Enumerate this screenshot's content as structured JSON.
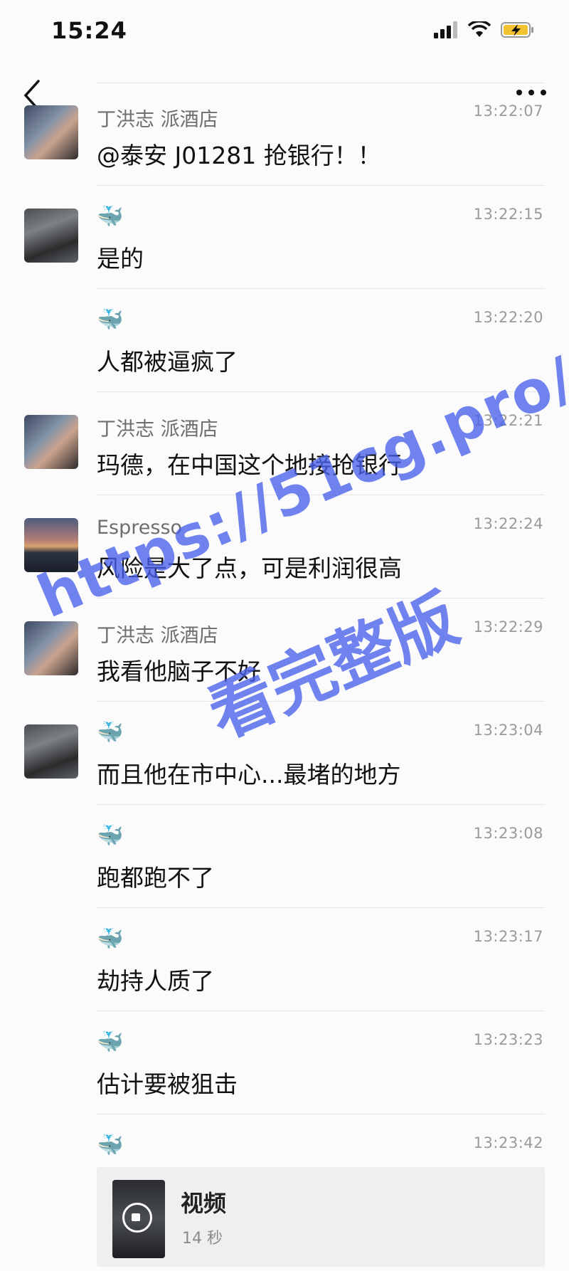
{
  "status_bar": {
    "time": "15:24"
  },
  "messages": [
    {
      "sender": "丁洪志 派酒店",
      "avatar": "couple-photo",
      "time": "13:22:07",
      "text": "@泰安 J01281 抢银行！！"
    },
    {
      "sender_icon": "🐳",
      "avatar": "dark-photo",
      "time": "13:22:15",
      "text": "是的"
    },
    {
      "sender_icon": "🐳",
      "avatar": "",
      "time": "13:22:20",
      "text": "人都被逼疯了"
    },
    {
      "sender": "丁洪志 派酒店",
      "avatar": "couple-photo",
      "time": "13:22:21",
      "text": "玛德，在中国这个地接抢银行"
    },
    {
      "sender": "Espresso",
      "avatar": "sunset-photo",
      "time": "13:22:24",
      "text": "风险是大了点，可是利润很高"
    },
    {
      "sender": "丁洪志 派酒店",
      "avatar": "couple-photo",
      "time": "13:22:29",
      "text": "我看他脑子不好"
    },
    {
      "sender_icon": "🐳",
      "avatar": "dark-photo",
      "time": "13:23:04",
      "text": "而且他在市中心...最堵的地方"
    },
    {
      "sender_icon": "🐳",
      "avatar": "",
      "time": "13:23:08",
      "text": "跑都跑不了"
    },
    {
      "sender_icon": "🐳",
      "avatar": "",
      "time": "13:23:17",
      "text": "劫持人质了"
    },
    {
      "sender_icon": "🐳",
      "avatar": "",
      "time": "13:23:23",
      "text": "估计要被狙击"
    }
  ],
  "video_message": {
    "sender_icon": "🐳",
    "time": "13:23:42",
    "title": "视频",
    "duration": "14 秒"
  },
  "watermark": {
    "url": "https://51cg.pro/",
    "cta": "看完整版"
  }
}
